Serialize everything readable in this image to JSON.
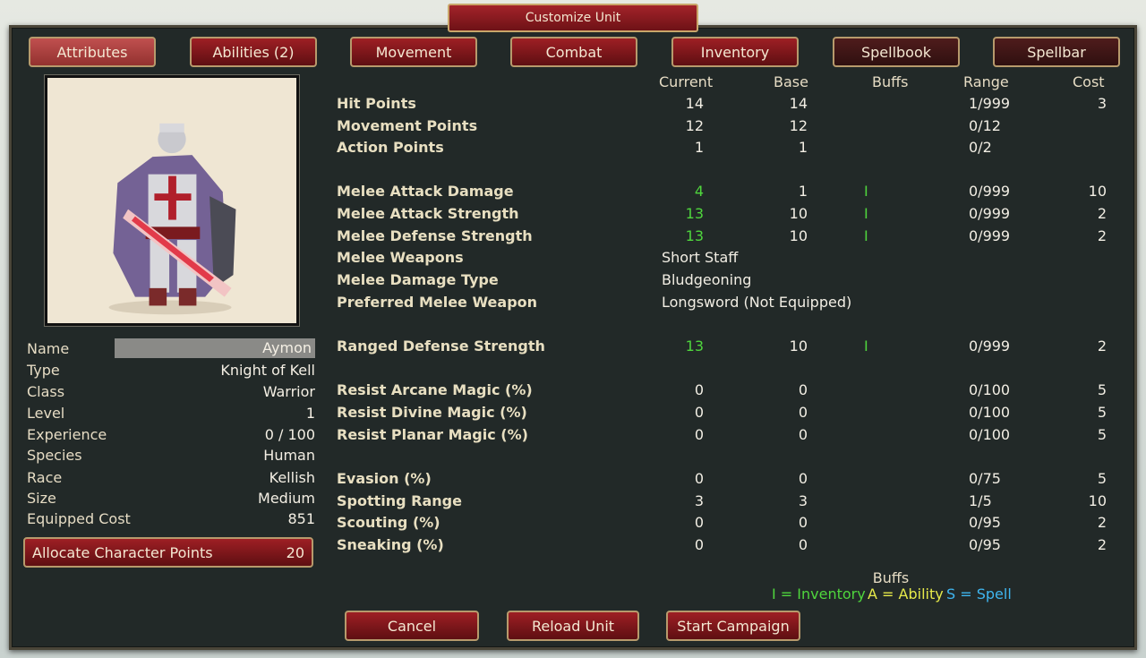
{
  "title": "Customize Unit",
  "tabs": [
    {
      "label": "Attributes"
    },
    {
      "label": "Abilities (2)"
    },
    {
      "label": "Movement"
    },
    {
      "label": "Combat"
    },
    {
      "label": "Inventory"
    },
    {
      "label": "Spellbook"
    },
    {
      "label": "Spellbar"
    }
  ],
  "character": {
    "name_label": "Name",
    "name": "Aymon",
    "type_label": "Type",
    "type": "Knight of Kell",
    "class_label": "Class",
    "class": "Warrior",
    "level_label": "Level",
    "level": "1",
    "experience_label": "Experience",
    "experience": "0 / 100",
    "species_label": "Species",
    "species": "Human",
    "race_label": "Race",
    "race": "Kellish",
    "size_label": "Size",
    "size": "Medium",
    "cost_label": "Equipped Cost",
    "cost": "851"
  },
  "allocate": {
    "label": "Allocate Character Points",
    "points": "20"
  },
  "columns": {
    "current": "Current",
    "base": "Base",
    "buffs": "Buffs",
    "range": "Range",
    "cost": "Cost"
  },
  "stats": [
    {
      "label": "Hit Points",
      "current": "14",
      "base": "14",
      "buff": "",
      "range": "1/999",
      "cost": "3"
    },
    {
      "label": "Movement Points",
      "current": "12",
      "base": "12",
      "buff": "",
      "range": "0/12",
      "cost": ""
    },
    {
      "label": "Action Points",
      "current": "1",
      "base": "1",
      "buff": "",
      "range": "0/2",
      "cost": ""
    },
    {
      "label": "Melee Attack Damage",
      "current": "4",
      "base": "1",
      "buff": "I",
      "range": "0/999",
      "cost": "10"
    },
    {
      "label": "Melee Attack Strength",
      "current": "13",
      "base": "10",
      "buff": "I",
      "range": "0/999",
      "cost": "2"
    },
    {
      "label": "Melee Defense Strength",
      "current": "13",
      "base": "10",
      "buff": "I",
      "range": "0/999",
      "cost": "2"
    },
    {
      "label": "Melee Weapons",
      "value": "Short Staff"
    },
    {
      "label": "Melee Damage Type",
      "value": "Bludgeoning"
    },
    {
      "label": "Preferred Melee Weapon",
      "value": "Longsword (Not Equipped)"
    },
    {
      "label": "Ranged Defense Strength",
      "current": "13",
      "base": "10",
      "buff": "I",
      "range": "0/999",
      "cost": "2"
    },
    {
      "label": "Resist Arcane Magic (%)",
      "current": "0",
      "base": "0",
      "buff": "",
      "range": "0/100",
      "cost": "5"
    },
    {
      "label": "Resist Divine Magic (%)",
      "current": "0",
      "base": "0",
      "buff": "",
      "range": "0/100",
      "cost": "5"
    },
    {
      "label": "Resist Planar Magic (%)",
      "current": "0",
      "base": "0",
      "buff": "",
      "range": "0/100",
      "cost": "5"
    },
    {
      "label": "Evasion (%)",
      "current": "0",
      "base": "0",
      "buff": "",
      "range": "0/75",
      "cost": "5"
    },
    {
      "label": "Spotting Range",
      "current": "3",
      "base": "3",
      "buff": "",
      "range": "1/5",
      "cost": "10"
    },
    {
      "label": "Scouting (%)",
      "current": "0",
      "base": "0",
      "buff": "",
      "range": "0/95",
      "cost": "2"
    },
    {
      "label": "Sneaking (%)",
      "current": "0",
      "base": "0",
      "buff": "",
      "range": "0/95",
      "cost": "2"
    }
  ],
  "legend": {
    "title": "Buffs",
    "inventory": "I = Inventory",
    "inventory_color": "#4fd63d",
    "ability": "A = Ability",
    "ability_color": "#e6e94a",
    "spell": "S = Spell",
    "spell_color": "#3fb6f0"
  },
  "buttons": {
    "cancel": "Cancel",
    "reload": "Reload Unit",
    "start": "Start Campaign"
  }
}
